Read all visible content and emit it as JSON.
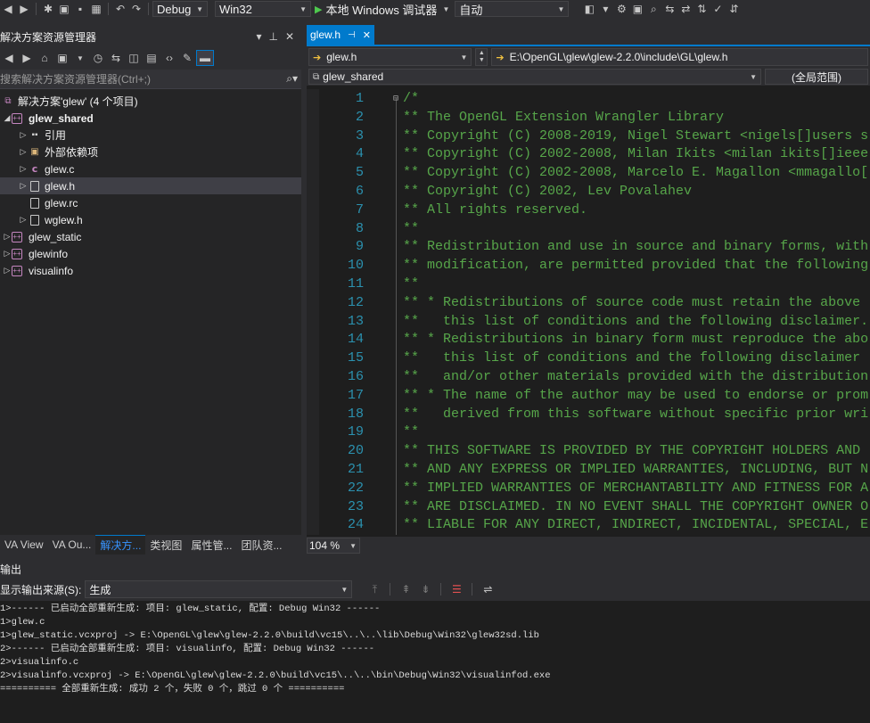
{
  "toolbar": {
    "config": "Debug",
    "platform": "Win32",
    "run_label": "本地 Windows 调试器",
    "run_mode": "自动"
  },
  "solution_explorer": {
    "title": "解决方案资源管理器",
    "search_placeholder": "搜索解决方案资源管理器(Ctrl+;)",
    "tree": {
      "solution": "解决方案'glew' (4 个项目)",
      "project_main": "glew_shared",
      "refs": "引用",
      "ext_deps": "外部依赖项",
      "file_c": "glew.c",
      "file_h": "glew.h",
      "file_rc": "glew.rc",
      "file_wglew": "wglew.h",
      "project_static": "glew_static",
      "project_info": "glewinfo",
      "project_visual": "visualinfo"
    },
    "tabs": [
      "VA View",
      "VA Ou...",
      "解决方...",
      "类视图",
      "属性管...",
      "团队资..."
    ]
  },
  "editor": {
    "tab_label": "glew.h",
    "tab_pin": "ꟸ",
    "file_dropdown": "glew.h",
    "path": "E:\\OpenGL\\glew\\glew-2.2.0\\include\\GL\\glew.h",
    "scope_project": "glew_shared",
    "scope_global": "(全局范围)",
    "zoom": "104 %",
    "lines": [
      {
        "n": "1",
        "t": "/*"
      },
      {
        "n": "2",
        "t": "** The OpenGL Extension Wrangler Library"
      },
      {
        "n": "3",
        "t": "** Copyright (C) 2008-2019, Nigel Stewart <nigels[]users s"
      },
      {
        "n": "4",
        "t": "** Copyright (C) 2002-2008, Milan Ikits <milan ikits[]ieee"
      },
      {
        "n": "5",
        "t": "** Copyright (C) 2002-2008, Marcelo E. Magallon <mmagallo["
      },
      {
        "n": "6",
        "t": "** Copyright (C) 2002, Lev Povalahev"
      },
      {
        "n": "7",
        "t": "** All rights reserved."
      },
      {
        "n": "8",
        "t": "**"
      },
      {
        "n": "9",
        "t": "** Redistribution and use in source and binary forms, with"
      },
      {
        "n": "10",
        "t": "** modification, are permitted provided that the following"
      },
      {
        "n": "11",
        "t": "**"
      },
      {
        "n": "12",
        "t": "** * Redistributions of source code must retain the above"
      },
      {
        "n": "13",
        "t": "**   this list of conditions and the following disclaimer."
      },
      {
        "n": "14",
        "t": "** * Redistributions in binary form must reproduce the abo"
      },
      {
        "n": "15",
        "t": "**   this list of conditions and the following disclaimer"
      },
      {
        "n": "16",
        "t": "**   and/or other materials provided with the distribution"
      },
      {
        "n": "17",
        "t": "** * The name of the author may be used to endorse or prom"
      },
      {
        "n": "18",
        "t": "**   derived from this software without specific prior wri"
      },
      {
        "n": "19",
        "t": "**"
      },
      {
        "n": "20",
        "t": "** THIS SOFTWARE IS PROVIDED BY THE COPYRIGHT HOLDERS AND"
      },
      {
        "n": "21",
        "t": "** AND ANY EXPRESS OR IMPLIED WARRANTIES, INCLUDING, BUT N"
      },
      {
        "n": "22",
        "t": "** IMPLIED WARRANTIES OF MERCHANTABILITY AND FITNESS FOR A"
      },
      {
        "n": "23",
        "t": "** ARE DISCLAIMED. IN NO EVENT SHALL THE COPYRIGHT OWNER O"
      },
      {
        "n": "24",
        "t": "** LIABLE FOR ANY DIRECT, INDIRECT, INCIDENTAL, SPECIAL, E"
      }
    ]
  },
  "output": {
    "title": "输出",
    "source_label": "显示输出来源(S):",
    "source_value": "生成",
    "lines": [
      "1>------ 已启动全部重新生成: 项目: glew_static, 配置: Debug Win32 ------",
      "1>glew.c",
      "1>glew_static.vcxproj -> E:\\OpenGL\\glew\\glew-2.2.0\\build\\vc15\\..\\..\\lib\\Debug\\Win32\\glew32sd.lib",
      "2>------ 已启动全部重新生成: 项目: visualinfo, 配置: Debug Win32 ------",
      "2>visualinfo.c",
      "2>visualinfo.vcxproj -> E:\\OpenGL\\glew\\glew-2.2.0\\build\\vc15\\..\\..\\bin\\Debug\\Win32\\visualinfod.exe",
      "========== 全部重新生成: 成功 2 个，失败 0 个，跳过 0 个 =========="
    ]
  }
}
